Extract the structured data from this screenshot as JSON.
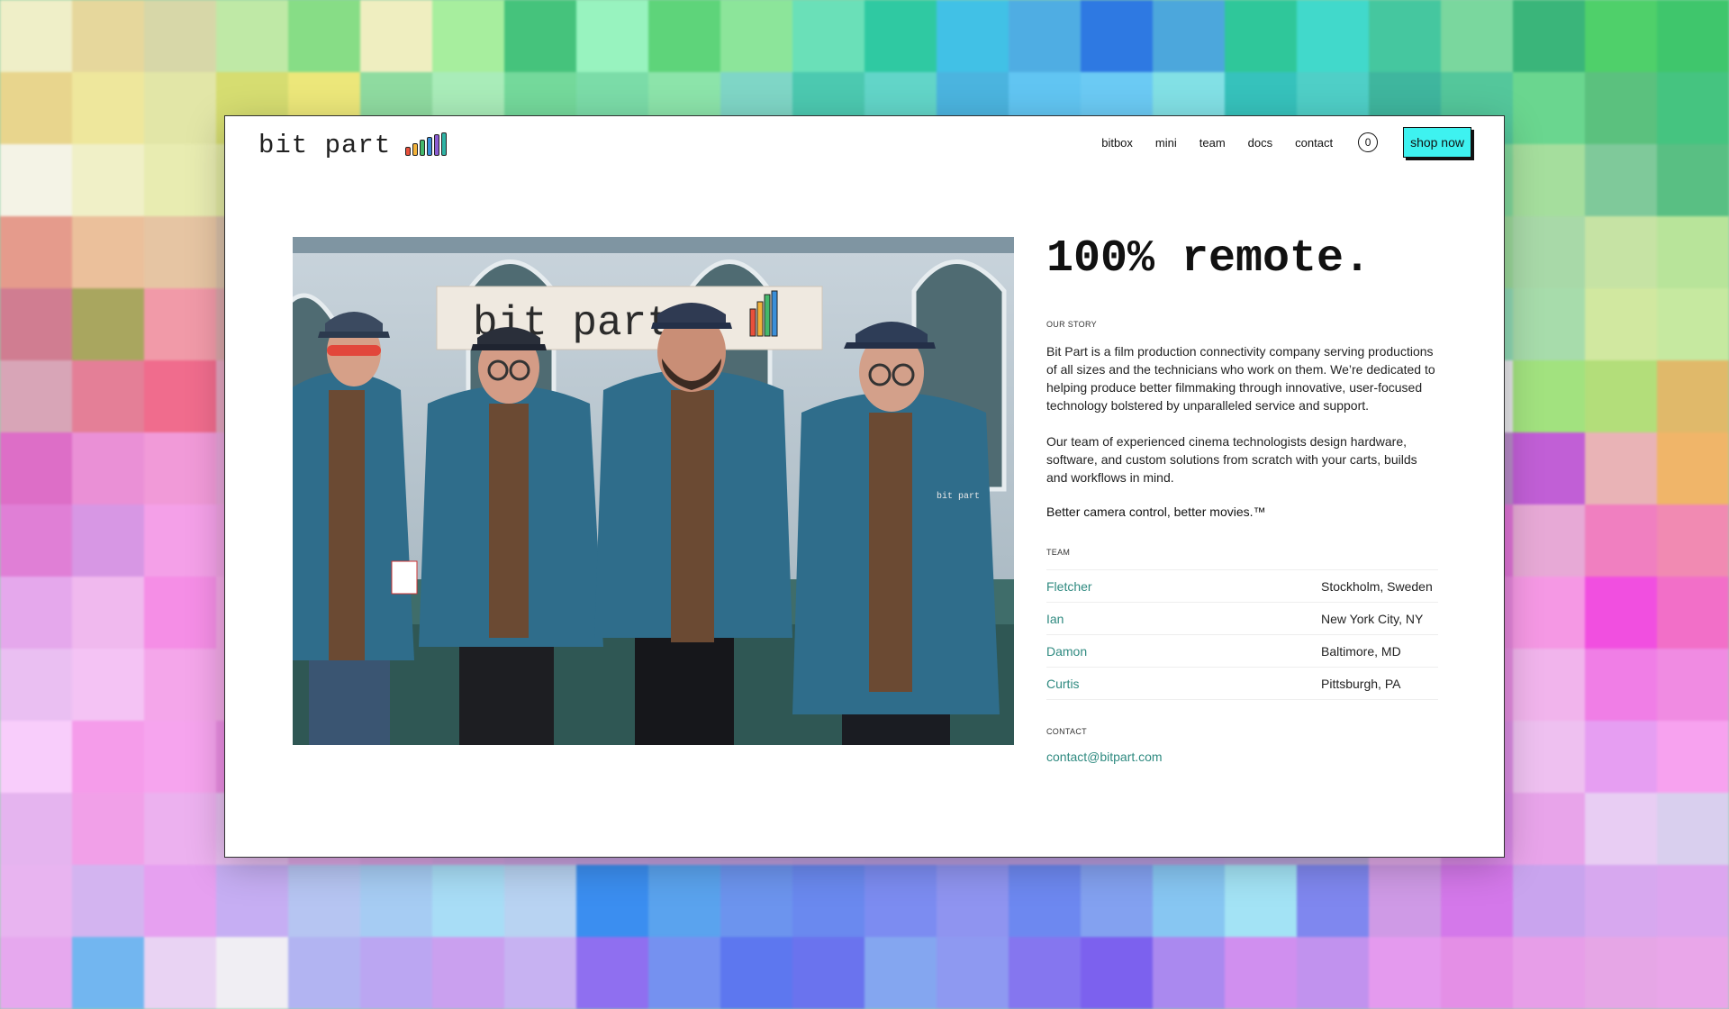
{
  "background": {
    "tiles": [
      "#efefc8",
      "#e6d79c",
      "#d7d7a8",
      "#bfe9a6",
      "#87dd86",
      "#efeec0",
      "#a7ee9e",
      "#45c37c",
      "#98f3bf",
      "#5ed47a",
      "#8ce59a",
      "#6ae0b8",
      "#2fc9a2",
      "#41c1e6",
      "#4fade3",
      "#2e79e2",
      "#4ca7dc",
      "#2fc79a",
      "#41d9cb",
      "#45c79f",
      "#7ad79e",
      "#3ab57a",
      "#4fd06a",
      "#3fc66c",
      "#e8d58d",
      "#eee79c",
      "#e2e6a7",
      "#d6dd71",
      "#ece77a",
      "#8fdba0",
      "#a9ecb9",
      "#74d99b",
      "#7bdca8",
      "#8ce4aa",
      "#7fd6c6",
      "#4cc9b0",
      "#62d5c8",
      "#4bb4df",
      "#61c5f2",
      "#6bcaf4",
      "#82e0e5",
      "#36c2bc",
      "#4fcfc7",
      "#3fb69e",
      "#54c79b",
      "#6ad68f",
      "#5bc17e",
      "#45c480",
      "#f4f3e6",
      "#f0f0c7",
      "#e8ecb1",
      "#e1e8a2",
      "#d5e8a0",
      "#c8eab0",
      "#a5e0ba",
      "#7ddcb0",
      "#6fd5a9",
      "#93e4c0",
      "#9ad8d0",
      "#74d5c2",
      "#6bd6c5",
      "#64cbe1",
      "#75c8ed",
      "#78c6ee",
      "#61c5d1",
      "#5fcab6",
      "#76d8c2",
      "#5cc8a8",
      "#82d89c",
      "#a5de9d",
      "#7fc99a",
      "#59bf83",
      "#e59b8c",
      "#ebc09b",
      "#e6c5a3",
      "#d8bfa7",
      "#c9b59f",
      "#d0c3b5",
      "#c8d3c3",
      "#aedcc0",
      "#a6dac6",
      "#b5dfcf",
      "#a5d0d0",
      "#9cccd7",
      "#8ec5d9",
      "#92c2de",
      "#9ac3e2",
      "#97c4e0",
      "#9dd0d5",
      "#94d3c5",
      "#a9dcc5",
      "#7bc89a",
      "#9bd89a",
      "#a8d9a8",
      "#c6e3a4",
      "#b8e49a",
      "#d07d91",
      "#a9a65f",
      "#f19aa8",
      "#d9a6a9",
      "#c8a7ae",
      "#c6b4b7",
      "#bdbcc4",
      "#b4c6c6",
      "#b0c5c8",
      "#b2c3cc",
      "#a8bcc8",
      "#a3b8c8",
      "#9fb5c8",
      "#a3b6ca",
      "#a8b7ca",
      "#a4b6cb",
      "#a3c1c7",
      "#9fcac2",
      "#a7d0c0",
      "#95c7aa",
      "#8fd8b4",
      "#a7dcab",
      "#d1e8a0",
      "#c6e9a0",
      "#d8a5b7",
      "#e47f97",
      "#f06c8d",
      "#e4a6c0",
      "#d8a6c4",
      "#cfa6c5",
      "#c6a7c6",
      "#bfa8c8",
      "#baaac9",
      "#b9a8ca",
      "#b3a3cb",
      "#aea2cb",
      "#ab9fcb",
      "#ae9fcc",
      "#b09fcc",
      "#ae9fcc",
      "#b1a8c6",
      "#b2b4c4",
      "#b4bdc4",
      "#c4b5c8",
      "#e7e7ea",
      "#a2e27f",
      "#b3de7a",
      "#e0b96a",
      "#dd6ec7",
      "#ea90d6",
      "#f19ad8",
      "#e8a5da",
      "#dea7d9",
      "#d7a5d6",
      "#cea4d4",
      "#c8a3d4",
      "#c4a3d4",
      "#c2a1d4",
      "#bfa0d4",
      "#bb9ed4",
      "#b89cd4",
      "#b99cd4",
      "#ba9cd4",
      "#b99cd4",
      "#b8a0d2",
      "#b8a9cf",
      "#b8acd0",
      "#c38fc7",
      "#b88bc9",
      "#c15fd6",
      "#e9b3b6",
      "#f0b569",
      "#e07fd6",
      "#d797e4",
      "#f4a0e8",
      "#efa2e2",
      "#e6a2de",
      "#dea0db",
      "#d5a0d9",
      "#cf9fd8",
      "#cb9ed8",
      "#c99dd8",
      "#c59cd8",
      "#c29bd8",
      "#bf9ad8",
      "#bf9ad8",
      "#c09ad8",
      "#bf9ad8",
      "#be9cd6",
      "#bea2d4",
      "#bea5d4",
      "#d38fd6",
      "#e074d7",
      "#e7a9d6",
      "#f07fc0",
      "#f18ab2",
      "#e5a8ec",
      "#f0b9ee",
      "#f58ee6",
      "#f3a8e6",
      "#eaa6e2",
      "#e2a4df",
      "#d9a3dd",
      "#d3a2dc",
      "#cfa1dc",
      "#cda0dc",
      "#c99fdc",
      "#c69edc",
      "#c39ddc",
      "#c39ddc",
      "#c49ddc",
      "#c39ddc",
      "#c29fda",
      "#c2a4d8",
      "#c2a7d8",
      "#e09fe2",
      "#e686dc",
      "#f598e4",
      "#f14fe0",
      "#f26fc8",
      "#eabff2",
      "#f4c3f4",
      "#f4a6ea",
      "#f2a9e7",
      "#eaa7e3",
      "#e2a5e0",
      "#d9a4de",
      "#d3a3dd",
      "#cfa2dd",
      "#cda1dd",
      "#c9a0dd",
      "#c69fdd",
      "#c39edd",
      "#c39edd",
      "#c49edd",
      "#c39edd",
      "#c2a0db",
      "#c2a5d9",
      "#c2a8d9",
      "#eaa4ea",
      "#e58de1",
      "#f1b4ec",
      "#f07ee6",
      "#f08be2",
      "#f8cdfb",
      "#f59cea",
      "#f6a4ee",
      "#ec8ee4",
      "#e59fe1",
      "#dfa3df",
      "#d7a4de",
      "#d1a3dd",
      "#cda2dd",
      "#cba1dd",
      "#c7a0dd",
      "#c49fdd",
      "#c19edd",
      "#c19edd",
      "#c29edd",
      "#c19edd",
      "#c0a0db",
      "#c0a5d9",
      "#c0a8d9",
      "#e6a8ea",
      "#dc8de4",
      "#eec0f0",
      "#e69ef2",
      "#f7a2ef",
      "#e5b4ef",
      "#f1a0e8",
      "#ecb1ef",
      "#e6bdef",
      "#dfa8e6",
      "#d8a3e2",
      "#d0a3e0",
      "#caa2df",
      "#c6a1df",
      "#c4a0df",
      "#c09fdf",
      "#bd9edf",
      "#ba9ddf",
      "#ba9ddf",
      "#bb9ddf",
      "#ba9ddf",
      "#b99fdd",
      "#b9a4db",
      "#b9a7db",
      "#e4aceb",
      "#da8ae7",
      "#e8a4ea",
      "#e8cdf3",
      "#d9cfee",
      "#e8b4f0",
      "#d3b4f0",
      "#e6a0f0",
      "#c6aef3",
      "#b6c5f2",
      "#a6ccf3",
      "#a8ddf6",
      "#b8d3f2",
      "#3b8ef0",
      "#5aa3ee",
      "#6c94ee",
      "#6a89ef",
      "#7c8cf1",
      "#8f94f0",
      "#6d88f0",
      "#83a1f0",
      "#87c6f2",
      "#a3e3f5",
      "#7f87ef",
      "#cf9ae6",
      "#d478ea",
      "#c9a4ee",
      "#d7a8ef",
      "#dca6ef",
      "#e6a8ee",
      "#72b6f0",
      "#e9d3f3",
      "#f0eef3",
      "#b2b4f2",
      "#bba6f2",
      "#caa0ef",
      "#c7b2f2",
      "#8f6ff0",
      "#7591f0",
      "#5d77ef",
      "#6a73ee",
      "#84a6f0",
      "#8e99f1",
      "#8576ef",
      "#7c61ee",
      "#aa89ef",
      "#d08fef",
      "#c192ee",
      "#e49aee",
      "#e48fe6",
      "#e79ee8",
      "#e6a6e6",
      "#e9a6e9"
    ]
  },
  "header": {
    "logo_text": "bit part",
    "logo_bar_colors": [
      "#e8503b",
      "#f2b23a",
      "#45b86b",
      "#3a8fd9",
      "#8a5bd1",
      "#2fb3a5"
    ],
    "nav": [
      "bitbox",
      "mini",
      "team",
      "docs",
      "contact"
    ],
    "cart_count": "0",
    "shop_label": "shop now"
  },
  "photo": {
    "banner_text": "bit part",
    "badge_text": "bit part"
  },
  "main": {
    "headline": "100% remote.",
    "story_label": "OUR STORY",
    "story_p1": "Bit Part is a film production connectivity company serving productions of all sizes and the technicians who work on them. We’re dedicated to helping produce better filmmaking through innovative, user-focused technology bolstered by unparalleled service and support.",
    "story_p2": "Our team of experienced cinema technologists design hardware, software, and custom solutions from scratch with your carts, builds and workflows in mind.",
    "tagline": "Better camera control, better movies.™",
    "team_label": "TEAM",
    "team": [
      {
        "name": "Fletcher",
        "location": "Stockholm, Sweden"
      },
      {
        "name": "Ian",
        "location": "New York City, NY"
      },
      {
        "name": "Damon",
        "location": "Baltimore, MD"
      },
      {
        "name": "Curtis",
        "location": "Pittsburgh, PA"
      }
    ],
    "contact_label": "CONTACT",
    "contact_email": "contact@bitpart.com"
  }
}
